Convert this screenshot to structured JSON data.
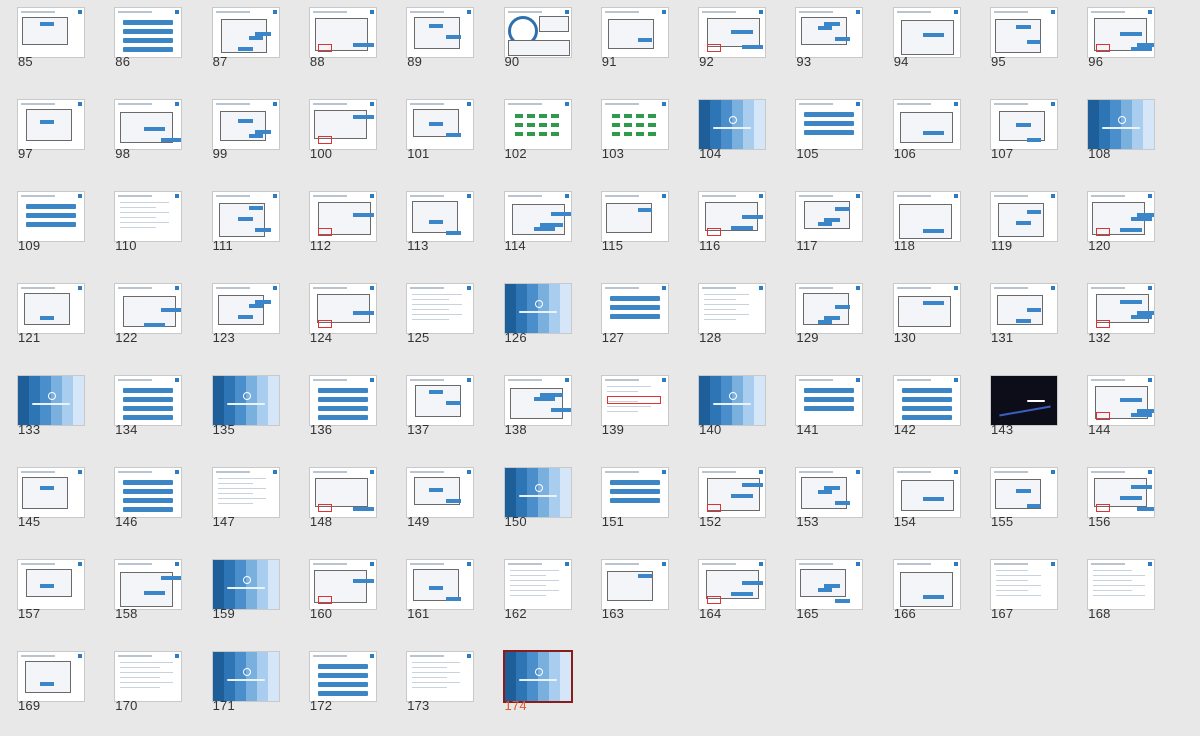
{
  "slide_numbers": [
    "85",
    "86",
    "87",
    "88",
    "89",
    "90",
    "91",
    "92",
    "93",
    "94",
    "95",
    "96",
    "97",
    "98",
    "99",
    "100",
    "101",
    "102",
    "103",
    "104",
    "105",
    "106",
    "107",
    "108",
    "109",
    "110",
    "111",
    "112",
    "113",
    "114",
    "115",
    "116",
    "117",
    "118",
    "119",
    "120",
    "121",
    "122",
    "123",
    "124",
    "125",
    "126",
    "127",
    "128",
    "129",
    "130",
    "131",
    "132",
    "133",
    "134",
    "135",
    "136",
    "137",
    "138",
    "139",
    "140",
    "141",
    "142",
    "143",
    "144",
    "145",
    "146",
    "147",
    "148",
    "149",
    "150",
    "151",
    "152",
    "153",
    "154",
    "155",
    "156",
    "157",
    "158",
    "159",
    "160",
    "161",
    "162",
    "163",
    "164",
    "165",
    "166",
    "167",
    "168",
    "169",
    "170",
    "171",
    "172",
    "173",
    "174"
  ],
  "selected_slide": "174",
  "colors": {
    "background": "#e8e8e8",
    "accent_blue": "#3d86c6",
    "selected_number": "#e05a2a",
    "selected_border": "#8a1c1c"
  },
  "section_slides": [
    "104",
    "108",
    "126",
    "133",
    "135",
    "140",
    "150",
    "159",
    "171",
    "174"
  ],
  "dark_slides": [
    "143"
  ],
  "thumbnail_kinds": {
    "85": "screenshot",
    "86": "bars",
    "87": "screenshot",
    "88": "screenshot",
    "89": "screenshot",
    "90": "circles",
    "91": "screenshot",
    "92": "screenshot",
    "93": "screenshot",
    "94": "screenshot",
    "95": "screenshot",
    "96": "screenshot",
    "97": "screenshot",
    "98": "screenshot",
    "99": "screenshot",
    "100": "screenshot",
    "101": "screenshot",
    "102": "flow",
    "103": "flow",
    "104": "section",
    "105": "bars",
    "106": "screenshot",
    "107": "screenshot",
    "108": "section",
    "109": "bars",
    "110": "text",
    "111": "screenshot",
    "112": "screenshot",
    "113": "screenshot",
    "114": "screenshot",
    "115": "screenshot",
    "116": "screenshot",
    "117": "screenshot",
    "118": "screenshot",
    "119": "screenshot",
    "120": "screenshot",
    "121": "screenshot",
    "122": "screenshot",
    "123": "screenshot",
    "124": "screenshot",
    "125": "text",
    "126": "section",
    "127": "bars",
    "128": "text",
    "129": "screenshot",
    "130": "screenshot",
    "131": "screenshot",
    "132": "screenshot",
    "133": "section",
    "134": "bars",
    "135": "section",
    "136": "bars",
    "137": "screenshot",
    "138": "screenshot",
    "139": "text",
    "140": "section",
    "141": "bars",
    "142": "bars",
    "143": "dark",
    "144": "screenshot",
    "145": "screenshot",
    "146": "bars",
    "147": "text",
    "148": "screenshot",
    "149": "screenshot",
    "150": "section",
    "151": "bars",
    "152": "screenshot",
    "153": "screenshot",
    "154": "screenshot",
    "155": "screenshot",
    "156": "screenshot",
    "157": "screenshot",
    "158": "screenshot",
    "159": "section",
    "160": "screenshot",
    "161": "screenshot",
    "162": "text",
    "163": "screenshot",
    "164": "screenshot",
    "165": "screenshot",
    "166": "screenshot",
    "167": "text",
    "168": "text",
    "169": "screenshot",
    "170": "text",
    "171": "section",
    "172": "bars",
    "173": "text",
    "174": "section"
  }
}
